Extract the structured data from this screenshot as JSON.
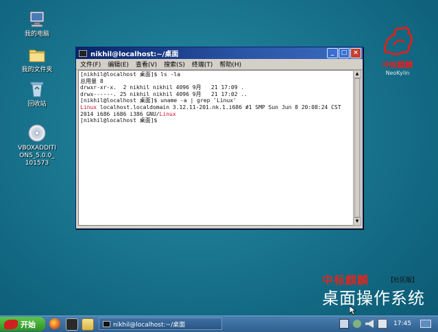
{
  "desktop": {
    "icons": [
      {
        "label": "我的电脑"
      },
      {
        "label": "我的文件夹"
      },
      {
        "label": "回收站"
      },
      {
        "label": "VBOXADDITIONS_5.0.0_101573"
      }
    ],
    "vbox_label_lines": [
      "VBOXADDITI",
      "ONS_5.0.0_",
      "101573"
    ]
  },
  "brand": {
    "cn": "中标麒麟",
    "en": "NeoKylin"
  },
  "bottom_brand": {
    "cn": "中标麒麟",
    "edition": "【社区版】",
    "slogan": "桌面操作系统"
  },
  "window": {
    "title": "nikhil@localhost:~/桌面",
    "menu": [
      "文件(F)",
      "编辑(E)",
      "查看(V)",
      "搜索(S)",
      "终端(T)",
      "帮助(H)"
    ],
    "lines": [
      {
        "text": "[nikhil@localhost 桌面]$ ls -la"
      },
      {
        "text": "总用量 8"
      },
      {
        "text": "drwxr-xr-x.  2 nikhil nikhil 4096 9月   21 17:09 ."
      },
      {
        "text": "drwx------. 25 nikhil nikhil 4096 9月   21 17:02 .."
      },
      {
        "text": "[nikhil@localhost 桌面]$ uname -a | grep 'Linux'"
      },
      {
        "prefix": "Linux",
        "text": " localhost.localdomain 3.12.11-201.nk.1.i686 #1 SMP Sun Jun 8 20:08:24 CST"
      },
      {
        "text": "2014 i686 i686 i386 GNU/",
        "suffix": "Linux"
      },
      {
        "text": "[nikhil@localhost 桌面]$"
      }
    ]
  },
  "taskbar": {
    "start_label": "开始",
    "task_title": "nikhil@localhost:~/桌面",
    "clock": "17:45"
  },
  "colors": {
    "desktop_bg": "#1d7a93",
    "title_bar": "#0a246a",
    "linux_highlight": "#c8102e",
    "start_button": "#3aa02c"
  }
}
